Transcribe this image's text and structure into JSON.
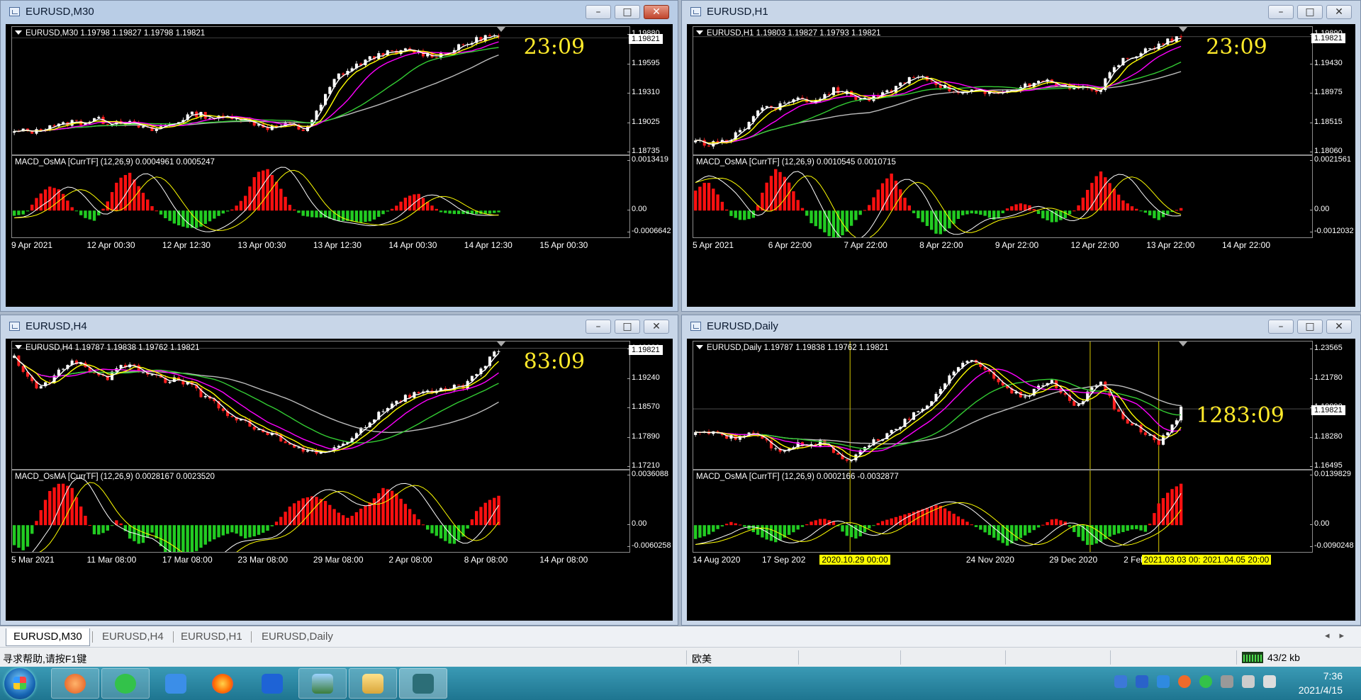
{
  "colors": {
    "bull": "#ffffff",
    "bear": "#ff2020",
    "ma_fast": "#ffffff",
    "ma_yellow": "#ffff00",
    "ma_magenta": "#ff00ff",
    "ma_green": "#33cc33",
    "ma_gray": "#bbbbbb",
    "hist_pos": "#ff1010",
    "hist_neg": "#22cc22",
    "clock": "#ffea2a"
  },
  "windows": [
    {
      "id": "m30",
      "title": "EURUSD,M30",
      "symbol_line": "EURUSD,M30  1.19798 1.19827 1.19798 1.19821",
      "clock": "23:09",
      "price": "1.19821",
      "y_ticks": [
        "1.19880",
        "1.19595",
        "1.19310",
        "1.19025",
        "1.18735"
      ],
      "macd_label": "MACD_OsMA [CurrTF] (12,26,9) 0.0004961 0.0005247",
      "macd_ticks": [
        "0.0013419",
        "0.00",
        "-0.0006642"
      ],
      "x_ticks": [
        "9 Apr 2021",
        "12 Apr 00:30",
        "12 Apr 12:30",
        "13 Apr 00:30",
        "13 Apr 12:30",
        "14 Apr 00:30",
        "14 Apr 12:30",
        "15 Apr 00:30"
      ],
      "chart_data": {
        "type": "candlestick",
        "ylim": [
          1.1865,
          1.1993
        ],
        "close_path": [
          1.1888,
          1.189,
          1.1889,
          1.1896,
          1.1895,
          1.1899,
          1.1898,
          1.1902,
          1.1898,
          1.19,
          1.1897,
          1.1893,
          1.189,
          1.1895,
          1.1898,
          1.1905,
          1.1907,
          1.1903,
          1.1902,
          1.1905,
          1.19,
          1.1897,
          1.1893,
          1.1894,
          1.1896,
          1.189,
          1.1903,
          1.1925,
          1.1945,
          1.195,
          1.1957,
          1.1962,
          1.1968,
          1.1966,
          1.197,
          1.1968,
          1.1965,
          1.1966,
          1.197,
          1.1975,
          1.198,
          1.1984,
          1.1982
        ],
        "macd_hist": [
          -0.00015,
          -0.0001,
          0.0004,
          0.0007,
          0.0006,
          0.0001,
          -0.0002,
          -0.0003,
          0.0002,
          0.0009,
          0.0011,
          0.0006,
          0.0001,
          -0.0002,
          -0.0004,
          -0.0005,
          -0.0005,
          -0.0003,
          -0.0001,
          5e-05,
          0.0004,
          0.0011,
          0.0012,
          0.0007,
          0.0001,
          -0.00015,
          -0.0002,
          -0.0002,
          -0.0003,
          -0.0003,
          -0.00035,
          -0.0003,
          -0.0001,
          0.0001,
          0.0004,
          0.0005,
          0.0002,
          -5e-05,
          -0.0001,
          -0.0001,
          -0.0001,
          -0.0001,
          -5e-05
        ]
      }
    },
    {
      "id": "h1",
      "title": "EURUSD,H1",
      "symbol_line": "EURUSD,H1  1.19803 1.19827 1.19793 1.19821",
      "clock": "23:09",
      "price": "1.19821",
      "y_ticks": [
        "1.19890",
        "1.19430",
        "1.18975",
        "1.18515",
        "1.18060"
      ],
      "macd_label": "MACD_OsMA [CurrTF] (12,26,9) 0.0010545 0.0010715",
      "macd_ticks": [
        "0.0021561",
        "0.00",
        "-0.0012032"
      ],
      "x_ticks": [
        "5 Apr 2021",
        "6 Apr 22:00",
        "7 Apr 22:00",
        "8 Apr 22:00",
        "9 Apr 22:00",
        "12 Apr 22:00",
        "13 Apr 22:00",
        "14 Apr 22:00"
      ],
      "chart_data": {
        "type": "candlestick",
        "ylim": [
          1.1788,
          1.1998
        ],
        "close_path": [
          1.181,
          1.1808,
          1.1806,
          1.1815,
          1.183,
          1.1855,
          1.187,
          1.1868,
          1.1878,
          1.1882,
          1.1876,
          1.1886,
          1.1895,
          1.189,
          1.1882,
          1.188,
          1.1885,
          1.1895,
          1.191,
          1.1915,
          1.1913,
          1.1905,
          1.1896,
          1.1893,
          1.1892,
          1.189,
          1.1894,
          1.1893,
          1.1898,
          1.1905,
          1.1908,
          1.1906,
          1.1902,
          1.1899,
          1.1895,
          1.1898,
          1.1925,
          1.1945,
          1.1952,
          1.196,
          1.1968,
          1.1975,
          1.1982
        ],
        "macd_hist": [
          0.0008,
          0.0012,
          0.0006,
          -0.0002,
          -0.0004,
          -0.0003,
          0.001,
          0.0017,
          0.0012,
          0.0003,
          -0.0005,
          -0.0008,
          -0.0012,
          -0.0009,
          -0.0003,
          0.0002,
          0.001,
          0.0015,
          0.0006,
          -0.0002,
          -0.0006,
          -0.001,
          -0.0007,
          -0.0002,
          -0.0001,
          -0.0002,
          -0.0004,
          0.0001,
          0.0003,
          0.0002,
          -0.0003,
          -0.0005,
          -0.0003,
          0.0001,
          0.0009,
          0.0016,
          0.001,
          0.0004,
          0.0001,
          -0.0001,
          -0.0004,
          -0.0001,
          0.0001
        ]
      }
    },
    {
      "id": "h4",
      "title": "EURUSD,H4",
      "symbol_line": "EURUSD,H4  1.19787 1.19838 1.19762 1.19821",
      "clock": "83:09",
      "price": "1.19821",
      "y_ticks": [
        "1.19920",
        "1.19240",
        "1.18570",
        "1.17890",
        "1.17210"
      ],
      "macd_label": "MACD_OsMA [CurrTF] (12,26,9) 0.0028167 0.0023520",
      "macd_ticks": [
        "0.0036088",
        "0.00",
        "-0.0060258"
      ],
      "x_ticks": [
        "5 Mar 2021",
        "11 Mar 08:00",
        "17 Mar 08:00",
        "23 Mar 08:00",
        "29 Mar 08:00",
        "2 Apr 08:00",
        "8 Apr 08:00",
        "14 Apr 08:00"
      ],
      "chart_data": {
        "type": "candlestick",
        "ylim": [
          1.17,
          1.1998
        ],
        "close_path": [
          1.196,
          1.192,
          1.1885,
          1.1905,
          1.1935,
          1.195,
          1.194,
          1.1925,
          1.191,
          1.1935,
          1.1945,
          1.193,
          1.192,
          1.1905,
          1.191,
          1.19,
          1.188,
          1.186,
          1.184,
          1.1825,
          1.181,
          1.1795,
          1.1785,
          1.1775,
          1.1765,
          1.1745,
          1.174,
          1.1745,
          1.1755,
          1.1765,
          1.179,
          1.182,
          1.184,
          1.186,
          1.187,
          1.188,
          1.1878,
          1.1885,
          1.189,
          1.1895,
          1.192,
          1.195,
          1.198
        ],
        "macd_hist": [
          -0.0015,
          -0.002,
          0.0005,
          0.0025,
          0.0032,
          0.0028,
          0.001,
          -0.0008,
          -0.0005,
          0.0005,
          -0.001,
          -0.0015,
          -0.0005,
          -0.002,
          -0.003,
          -0.0025,
          -0.0018,
          -0.0012,
          -0.0008,
          -0.0005,
          -0.001,
          -0.0008,
          -0.0004,
          0.0005,
          0.0015,
          0.002,
          0.0022,
          0.0018,
          0.001,
          0.0005,
          0.0012,
          0.0018,
          0.0028,
          0.0025,
          0.0015,
          0.0005,
          -0.0005,
          -0.001,
          -0.0015,
          -0.0008,
          0.001,
          0.0018,
          0.0022
        ]
      }
    },
    {
      "id": "daily",
      "title": "EURUSD,Daily",
      "symbol_line": "EURUSD,Daily  1.19787 1.19838 1.19762 1.19821",
      "clock": "1283:09",
      "price": "1.19821",
      "y_ticks": [
        "1.23565",
        "1.21780",
        "1.19990",
        "1.18280",
        "1.16495"
      ],
      "macd_label": "MACD_OsMA [CurrTF] (12,26,9) 0.0002166 -0.0032877",
      "macd_ticks": [
        "0.0139829",
        "0.00",
        "-0.0090248"
      ],
      "x_ticks": [
        "14 Aug 2020",
        "17 Sep 202",
        "24 Nov 2020",
        "29 Dec 2020",
        "2 Feb",
        "021"
      ],
      "x_highlights": [
        "2020.10.29 00:00",
        "2021.03.03 00: 2021.04.05 20:00"
      ],
      "chart_data": {
        "type": "candlestick",
        "ylim": [
          1.16,
          1.24
        ],
        "close_path": [
          1.182,
          1.184,
          1.183,
          1.18,
          1.181,
          1.184,
          1.179,
          1.172,
          1.174,
          1.176,
          1.175,
          1.178,
          1.172,
          1.165,
          1.17,
          1.176,
          1.18,
          1.185,
          1.19,
          1.195,
          1.2,
          1.21,
          1.22,
          1.225,
          1.23,
          1.223,
          1.215,
          1.212,
          1.205,
          1.208,
          1.213,
          1.215,
          1.205,
          1.2,
          1.208,
          1.215,
          1.202,
          1.19,
          1.188,
          1.182,
          1.176,
          1.185,
          1.198
        ],
        "macd_hist": [
          -0.004,
          -0.003,
          -0.001,
          0.001,
          0.0,
          -0.002,
          -0.004,
          -0.005,
          -0.003,
          -0.001,
          0.001,
          0.002,
          0.001,
          -0.003,
          -0.004,
          -0.001,
          0.001,
          0.002,
          0.003,
          0.004,
          0.005,
          0.006,
          0.004,
          0.002,
          0.0,
          -0.002,
          -0.004,
          -0.006,
          -0.004,
          -0.002,
          0.0,
          0.002,
          0.001,
          -0.003,
          -0.006,
          -0.005,
          -0.003,
          -0.002,
          -0.001,
          -0.002,
          0.006,
          0.01,
          0.012
        ]
      }
    }
  ],
  "tabs": [
    {
      "label": "EURUSD,M30",
      "active": true
    },
    {
      "label": "EURUSD,H4"
    },
    {
      "label": "EURUSD,H1"
    },
    {
      "label": "EURUSD,Daily"
    }
  ],
  "status": {
    "help": "寻求帮助,请按F1键",
    "profile": "欧美",
    "traffic": "43/2 kb"
  },
  "taskbar": {
    "time": "7:36",
    "date": "2021/4/15"
  }
}
